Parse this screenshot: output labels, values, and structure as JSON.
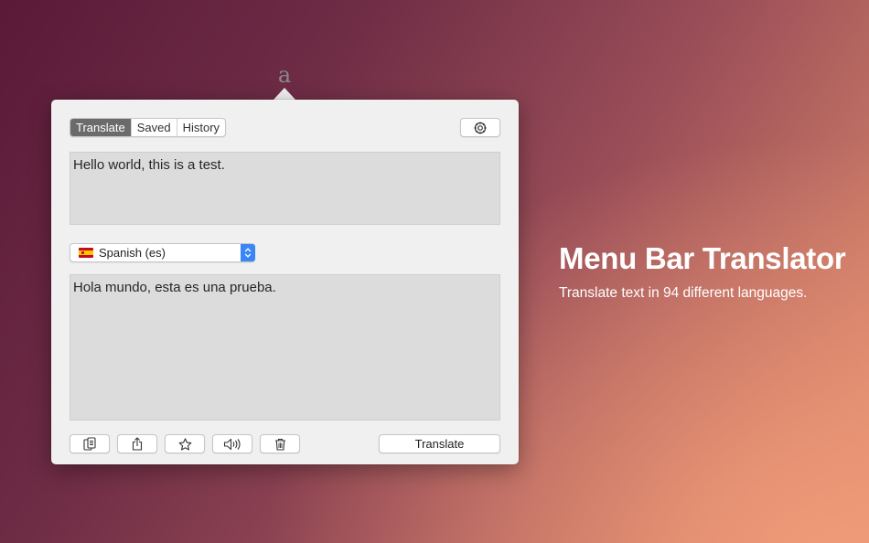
{
  "menubar": {
    "icon_glyph": "a",
    "icon": "translate-letter-icon"
  },
  "tabs": [
    {
      "label": "Translate",
      "active": true
    },
    {
      "label": "Saved",
      "active": false
    },
    {
      "label": "History",
      "active": false
    }
  ],
  "settings": {
    "icon": "gear-icon"
  },
  "source": {
    "text": "Hello world, this is a test."
  },
  "target_language": {
    "label": "Spanish (es)",
    "flag": "spain-flag-icon"
  },
  "target": {
    "text": "Hola mundo, esta es una prueba."
  },
  "toolbar": {
    "buttons": [
      {
        "name": "copy",
        "icon": "copy-icon"
      },
      {
        "name": "share",
        "icon": "share-icon"
      },
      {
        "name": "save",
        "icon": "star-icon"
      },
      {
        "name": "speak",
        "icon": "speaker-icon"
      },
      {
        "name": "delete",
        "icon": "trash-icon"
      }
    ],
    "translate_label": "Translate"
  },
  "hero": {
    "title": "Menu Bar Translator",
    "subtitle": "Translate text in 94 different languages."
  },
  "colors": {
    "accent": "#3b86f7",
    "active_tab": "#6b6b6b",
    "panel": "#f0f0f0",
    "textbox": "#dcdcdc"
  }
}
